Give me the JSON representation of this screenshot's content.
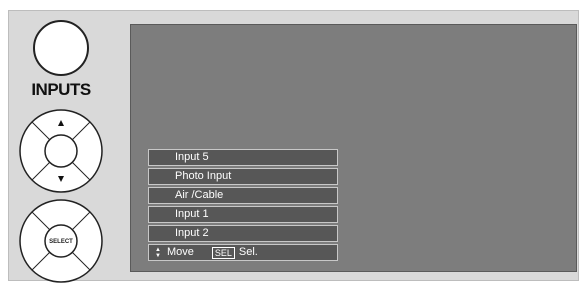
{
  "remote": {
    "inputs_label": "INPUTS",
    "select_label": "SELECT",
    "icons": [
      "inputs-button",
      "up-arrow-icon",
      "down-arrow-icon",
      "select-button"
    ]
  },
  "menu": {
    "items": [
      {
        "label": "Input 5"
      },
      {
        "label": "Photo Input"
      },
      {
        "label": "Air /Cable"
      },
      {
        "label": "Input 1"
      },
      {
        "label": "Input 2"
      }
    ],
    "hint": {
      "move_label": "Move",
      "sel_key": "SEL",
      "sel_label": "Sel."
    }
  },
  "colors": {
    "screen": "#7d7d7d",
    "menu_item_bg": "#575757",
    "menu_border": "#c8c8c8",
    "panel": "#d9d9d9"
  }
}
